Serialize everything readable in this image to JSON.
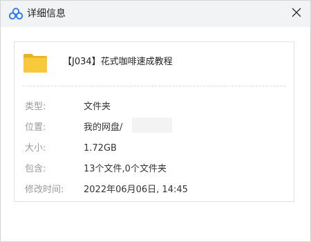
{
  "window": {
    "title": "详细信息",
    "close_glyph": "×"
  },
  "file": {
    "icon": "folder-icon",
    "name": "【J034】花式咖啡速成教程"
  },
  "properties": [
    {
      "label": "类型:",
      "value": "文件夹"
    },
    {
      "label": "位置:",
      "value": "我的网盘/"
    },
    {
      "label": "大小:",
      "value": "1.72GB"
    },
    {
      "label": "包含:",
      "value": "13个文件,0个文件夹"
    },
    {
      "label": "修改时间:",
      "value": "2022年06月06日, 14:45"
    }
  ],
  "colors": {
    "titlebar_bg": "#f2f3f5",
    "folder": "#f9c93c",
    "logo": "#2f7cf6"
  }
}
